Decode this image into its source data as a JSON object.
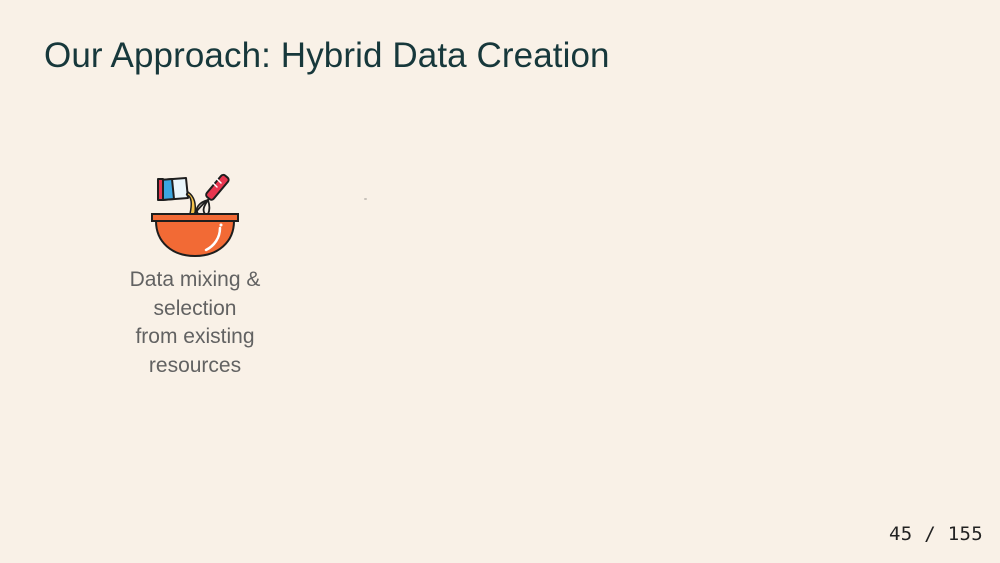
{
  "slide": {
    "title": "Our Approach: Hybrid Data Creation",
    "items": [
      {
        "icon": "mixing-bowl-icon",
        "caption": "Data mixing &\nselection\nfrom existing\nresources"
      }
    ],
    "page_number": {
      "current": "45",
      "separator": "/",
      "total": "155"
    }
  },
  "colors": {
    "background": "#f9f1e7",
    "title": "#17383b",
    "caption": "#626262",
    "bowl": "#f26a35",
    "whisk_handle": "#e8364f",
    "cup": "#3aa6e0"
  }
}
